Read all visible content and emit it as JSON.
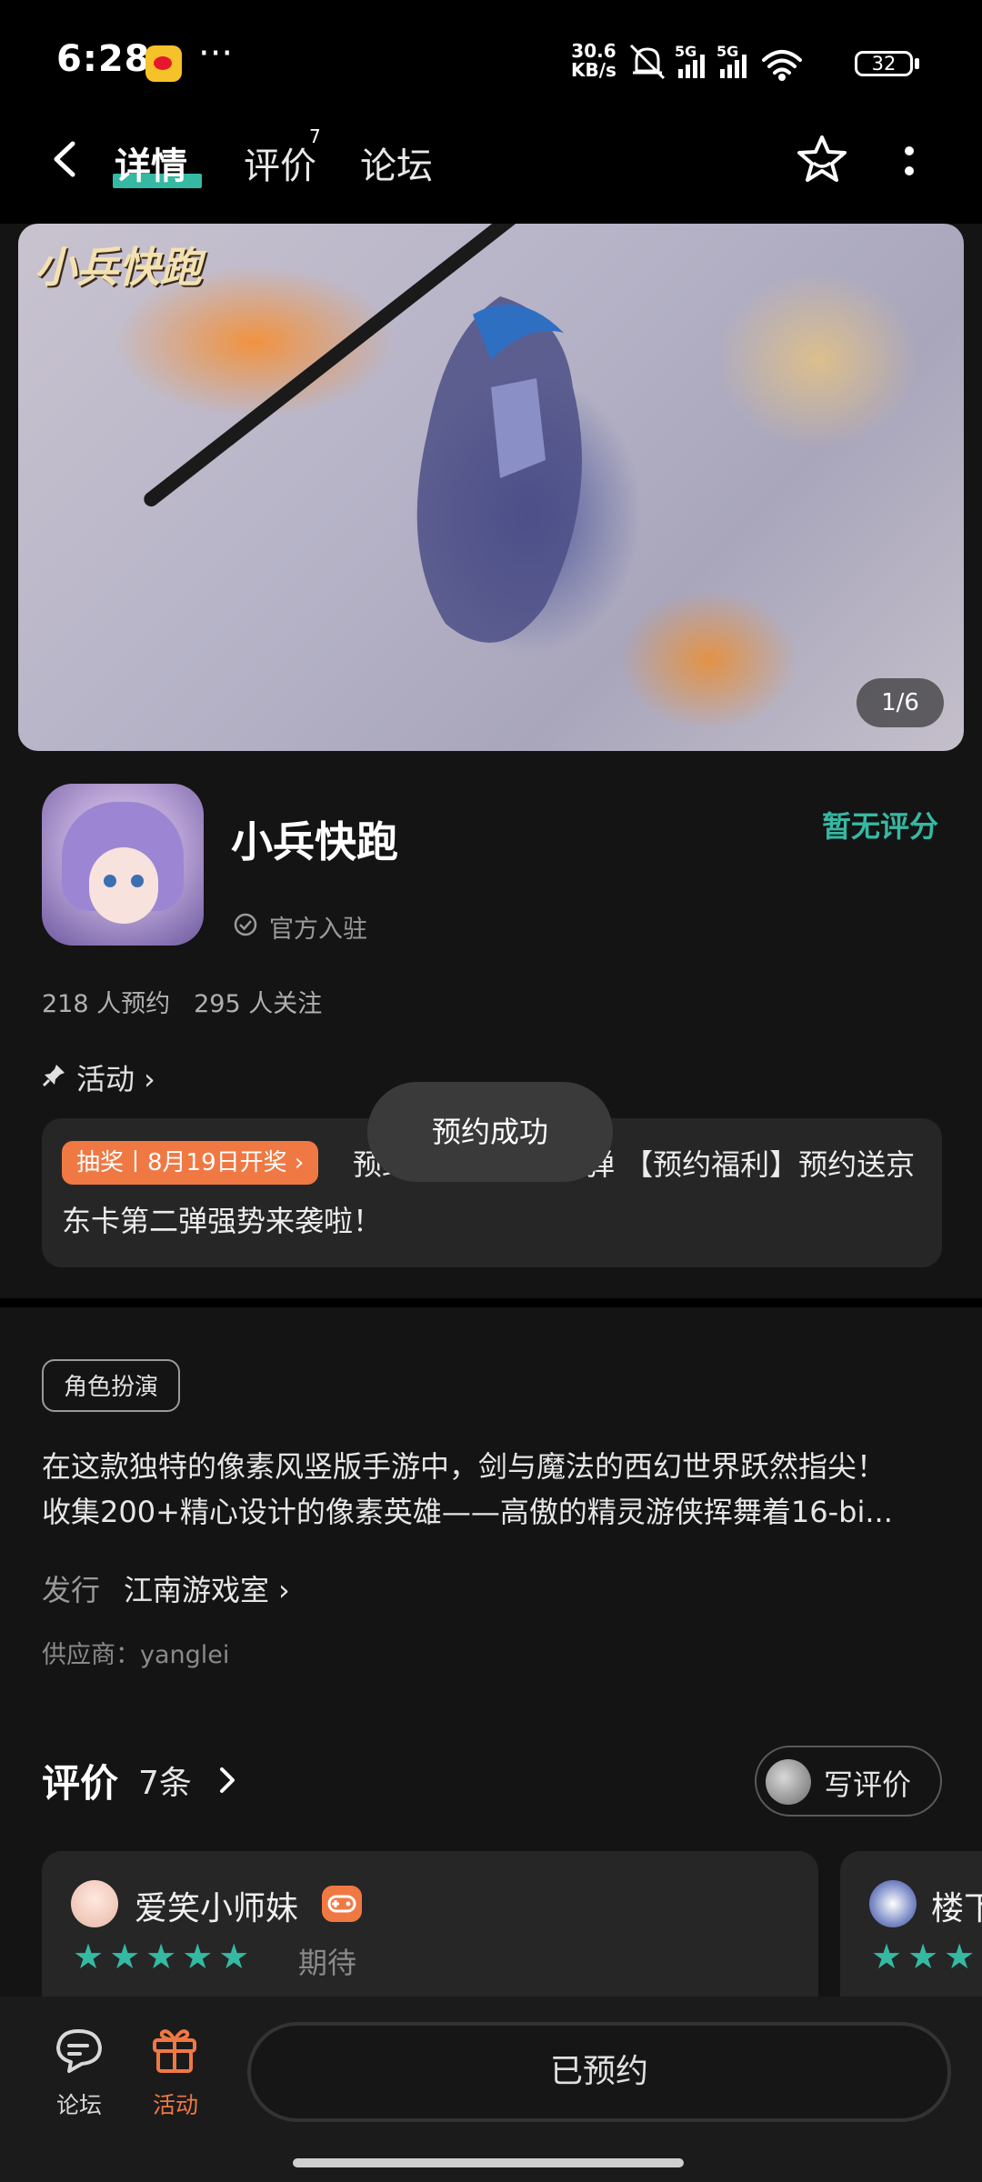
{
  "status_bar": {
    "time": "6:28",
    "network_speed_value": "30.6",
    "network_speed_unit": "KB/s",
    "battery": "32",
    "icons": [
      "weibo-icon",
      "more-dots-icon",
      "mute-icon",
      "5g-signal-icon",
      "5g-signal-icon",
      "wifi-icon",
      "battery-icon"
    ]
  },
  "nav": {
    "tabs": [
      {
        "label": "详情",
        "active": true
      },
      {
        "label": "评价",
        "badge": "7"
      },
      {
        "label": "论坛"
      }
    ]
  },
  "banner": {
    "logo_text": "小兵快跑",
    "counter": "1/6"
  },
  "app": {
    "name": "小兵快跑",
    "official": "官方入驻",
    "rating": "暂无评分",
    "reservations": "218 人预约",
    "followers": "295 人关注"
  },
  "activity": {
    "title": "活动",
    "badge": "抽奖丨8月19日开奖 ›",
    "text": "预约送京东卡第二弹 【预约福利】预约送京东卡第二弹强势来袭啦！"
  },
  "toast": "预约成功",
  "details": {
    "tag": "角色扮演",
    "description_lines": [
      "在这款独特的像素风竖版手游中，剑与魔法的西幻世界跃然指尖！",
      "收集200+精心设计的像素英雄——高傲的精灵游侠挥舞着16-bi..."
    ],
    "publisher_label": "发行",
    "publisher": "江南游戏室",
    "supplier": "供应商：yanglei"
  },
  "reviews": {
    "title": "评价",
    "count": "7条",
    "write_label": "写评价",
    "items": [
      {
        "name": "爱笑小师妹",
        "stars": 5,
        "stars_text": "★★★★★",
        "tag": "期待"
      },
      {
        "name": "楼下",
        "stars_text": "★★★"
      }
    ]
  },
  "bottom_bar": {
    "forum_label": "论坛",
    "activity_label": "活动",
    "reserve_button": "已预约"
  },
  "colors": {
    "accent": "#35b9a3",
    "orange": "#f07843",
    "background": "#141414"
  }
}
